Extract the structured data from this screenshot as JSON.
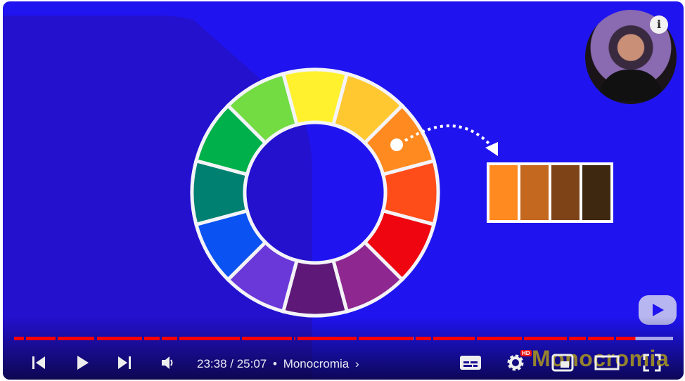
{
  "video": {
    "current_time": "23:38",
    "duration": "25:07",
    "time_display": "23:38 / 25:07",
    "separator": "•",
    "chapter": "Monocromia",
    "watermark": "Monocromia",
    "progress_percent": 94,
    "hd_badge": "HD"
  },
  "wheel": {
    "colors": [
      "#fff12e",
      "#ffc830",
      "#ff8a20",
      "#ff4d1a",
      "#ee0510",
      "#8e2890",
      "#5e1878",
      "#6a38d8",
      "#0a52f2",
      "#008070",
      "#00b04a",
      "#72dc42"
    ],
    "selected_index": 2
  },
  "palette": {
    "colors": [
      "#ff8a20",
      "#c4671f",
      "#7e4418",
      "#3f2810"
    ]
  },
  "colors": {
    "background": "#1f14f0",
    "progress": "#ff0000",
    "buffer": "#a8a6e8"
  },
  "icons": [
    "previous-icon",
    "play-icon",
    "next-icon",
    "volume-icon",
    "chevron-right-icon",
    "subtitles-icon",
    "settings-icon",
    "miniplayer-icon",
    "theater-icon",
    "fullscreen-icon",
    "info-icon",
    "channel-logo-icon"
  ]
}
